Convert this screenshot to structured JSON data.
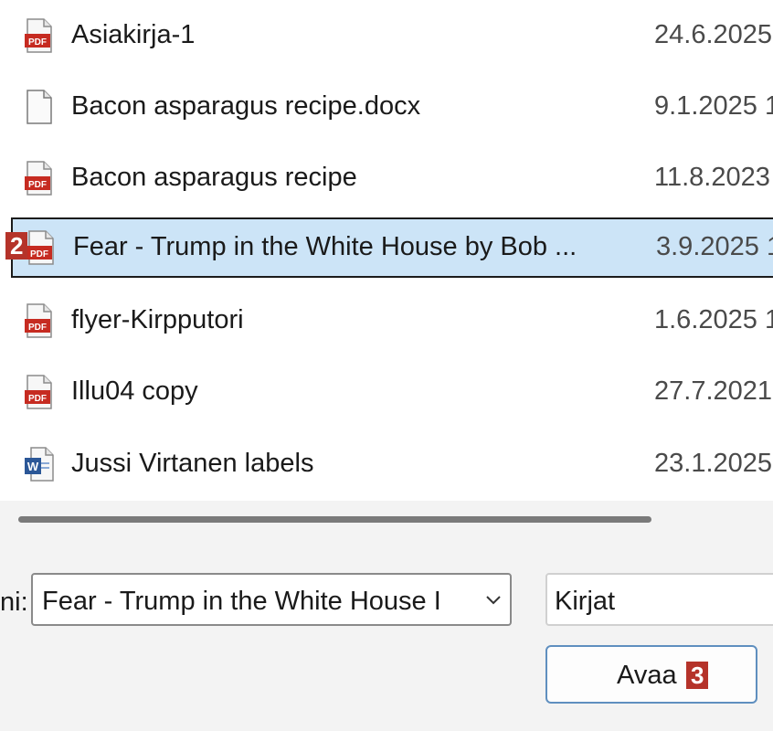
{
  "files": [
    {
      "name": "Asiakirja-1",
      "date": "24.6.2025",
      "icon": "pdf-file-icon"
    },
    {
      "name": "Bacon asparagus recipe.docx",
      "date": "9.1.2025 1",
      "icon": "blank-file-icon"
    },
    {
      "name": "Bacon asparagus recipe",
      "date": "11.8.2023",
      "icon": "pdf-file-icon"
    },
    {
      "name": "Fear - Trump in the White House by Bob ...",
      "date": "3.9.2025 1",
      "icon": "pdf-file-icon",
      "selected": true
    },
    {
      "name": "flyer-Kirpputori",
      "date": "1.6.2025 1",
      "icon": "pdf-file-icon"
    },
    {
      "name": "Illu04 copy",
      "date": "27.7.2021",
      "icon": "pdf-file-icon"
    },
    {
      "name": "Jussi Virtanen labels",
      "date": "23.1.2025",
      "icon": "word-file-icon"
    }
  ],
  "badges": {
    "file_badge": "2",
    "button_badge": "3"
  },
  "footer": {
    "filename_label": "ni:",
    "filename_value": "Fear - Trump in the White House I",
    "filetype_value": "Kirjat",
    "open_button_label": "Avaa"
  },
  "colors": {
    "selected_row": "#cce4f7",
    "badge": "#b5332a",
    "pdf_red": "#c62b21",
    "word_blue": "#2b5797"
  }
}
